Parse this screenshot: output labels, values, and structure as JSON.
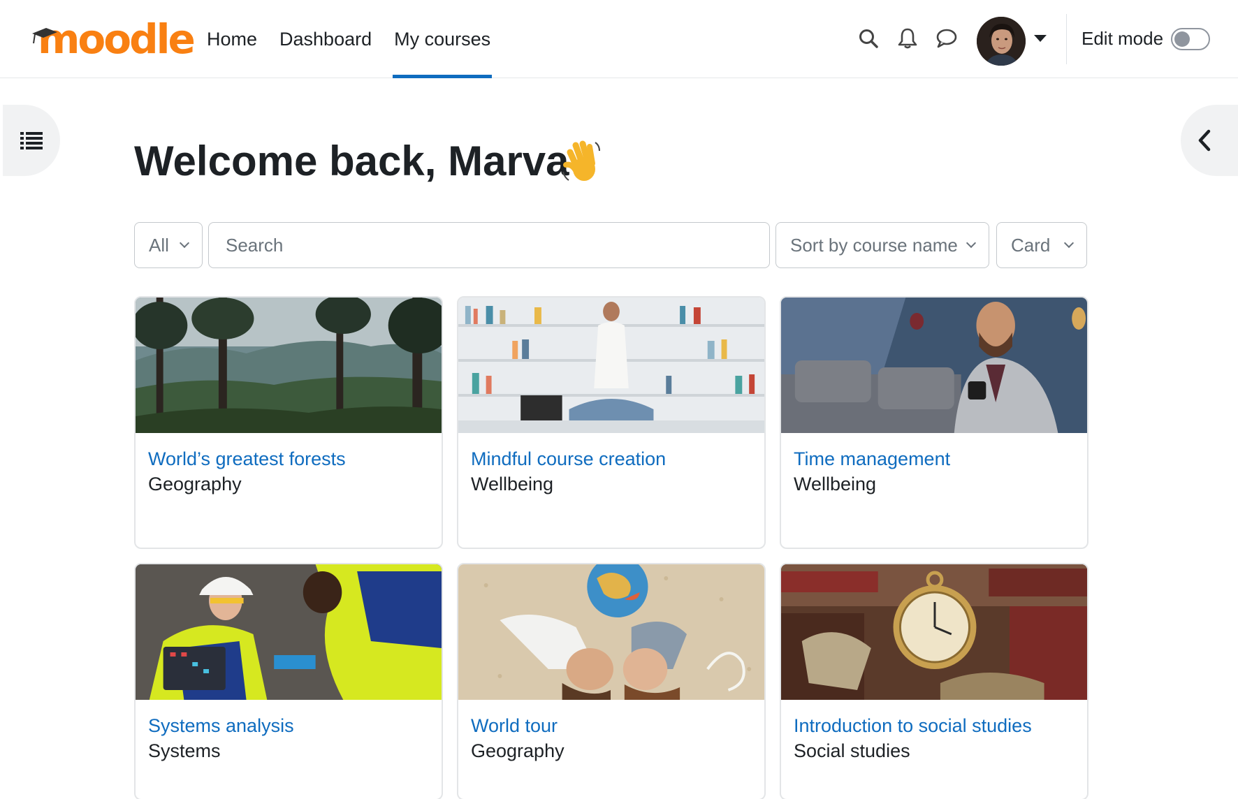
{
  "brand": {
    "logo_text": "moodle",
    "accent": "#f98012",
    "link_color": "#0f6cbf"
  },
  "nav": {
    "links": [
      {
        "label": "Home",
        "active": false
      },
      {
        "label": "Dashboard",
        "active": false
      },
      {
        "label": "My courses",
        "active": true
      }
    ],
    "icons": [
      "search-icon",
      "bell-icon",
      "chat-icon"
    ],
    "edit_mode_label": "Edit mode",
    "edit_mode_on": false
  },
  "page": {
    "title": "Welcome back, Marva",
    "title_icon": "waving-hand-icon"
  },
  "filters": {
    "grouping": "All",
    "search_placeholder": "Search",
    "sort": "Sort by course name",
    "view": "Card"
  },
  "courses": [
    {
      "name": "World’s greatest forests",
      "category": "Geography",
      "image": "forest-image"
    },
    {
      "name": "Mindful course creation",
      "category": "Wellbeing",
      "image": "meditation-library-image"
    },
    {
      "name": "Time management",
      "category": "Wellbeing",
      "image": "man-checking-watch-image"
    },
    {
      "name": "Systems analysis",
      "category": "Systems",
      "image": "engineers-circuit-image"
    },
    {
      "name": "World tour",
      "category": "Geography",
      "image": "couple-with-globe-image"
    },
    {
      "name": "Introduction to social studies",
      "category": "Social studies",
      "image": "pocket-watch-books-image"
    }
  ]
}
